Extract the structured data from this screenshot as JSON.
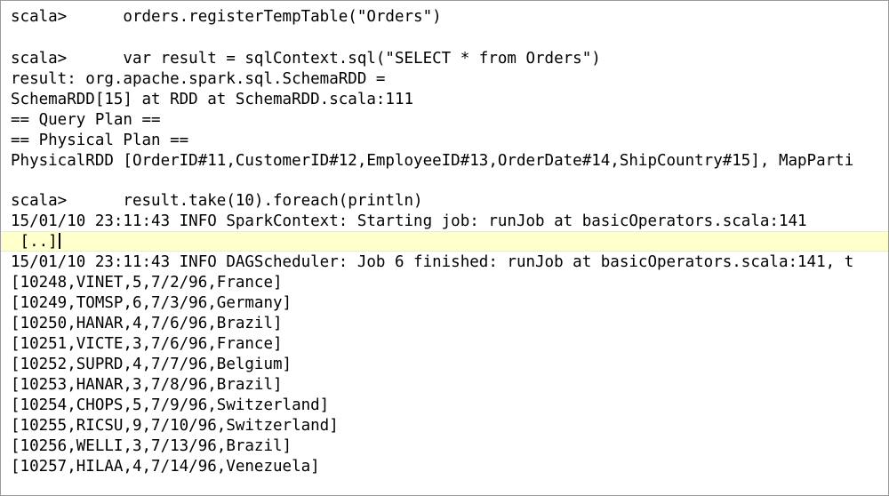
{
  "console": {
    "lines": [
      "scala>      orders.registerTempTable(\"Orders\")",
      "",
      "scala>      var result = sqlContext.sql(\"SELECT * from Orders\")",
      "result: org.apache.spark.sql.SchemaRDD =",
      "SchemaRDD[15] at RDD at SchemaRDD.scala:111",
      "== Query Plan ==",
      "== Physical Plan ==",
      "PhysicalRDD [OrderID#11,CustomerID#12,EmployeeID#13,OrderDate#14,ShipCountry#15], MapParti",
      "",
      "scala>      result.take(10).foreach(println)",
      "15/01/10 23:11:43 INFO SparkContext: Starting job: runJob at basicOperators.scala:141",
      " [..]",
      "15/01/10 23:11:43 INFO DAGScheduler: Job 6 finished: runJob at basicOperators.scala:141, t",
      "[10248,VINET,5,7/2/96,France]",
      "[10249,TOMSP,6,7/3/96,Germany]",
      "[10250,HANAR,4,7/6/96,Brazil]",
      "[10251,VICTE,3,7/6/96,France]",
      "[10252,SUPRD,4,7/7/96,Belgium]",
      "[10253,HANAR,3,7/8/96,Brazil]",
      "[10254,CHOPS,5,7/9/96,Switzerland]",
      "[10255,RICSU,9,7/10/96,Switzerland]",
      "[10256,WELLI,3,7/13/96,Brazil]",
      "[10257,HILAA,4,7/14/96,Venezuela]"
    ],
    "highlight_color": "#ffffcc",
    "text_color": "#000000"
  }
}
